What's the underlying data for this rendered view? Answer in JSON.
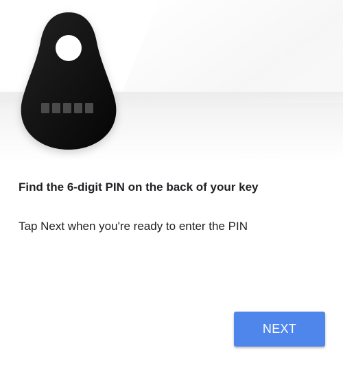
{
  "header": {
    "illustration_icon": "security-key-fob-icon"
  },
  "content": {
    "title": "Find the 6-digit PIN on the back of your key",
    "subtitle": "Tap Next when you're ready to enter the PIN"
  },
  "actions": {
    "next_label": "NEXT"
  },
  "colors": {
    "accent": "#4f86ec",
    "text": "#202124",
    "key_body": "#151515"
  }
}
